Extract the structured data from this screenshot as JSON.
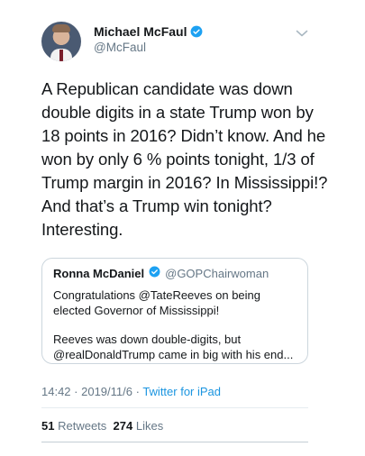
{
  "author": {
    "name": "Michael McFaul",
    "handle": "@McFaul",
    "verified": true
  },
  "tweet": {
    "text": "A Republican candidate was down double digits in a state Trump won by 18 points in 2016? Didn’t know. And he won by only 6 % points tonight, 1/3 of Trump margin in 2016? In Mississippi!? And that’s a Trump win tonight? Interesting."
  },
  "quoted_tweet": {
    "name": "Ronna McDaniel",
    "handle": "@GOPChairwoman",
    "verified": true,
    "text_1": "Congratulations @TateReeves on being elected Governor of Mississippi!",
    "text_2": "Reeves was down double-digits, but @realDonaldTrump came in big with his end..."
  },
  "meta": {
    "time": "14:42",
    "separator": " · ",
    "date": "2019/11/6",
    "source": "Twitter for iPad"
  },
  "stats": {
    "retweets_count": "51",
    "retweets_label": "Retweets",
    "likes_count": "274",
    "likes_label": "Likes"
  },
  "colors": {
    "verified_badge": "#1da1f2",
    "link": "#1b95e0",
    "secondary_text": "#657786"
  },
  "icons": {
    "verified": "verified-badge-icon",
    "menu": "chevron-down-icon"
  }
}
